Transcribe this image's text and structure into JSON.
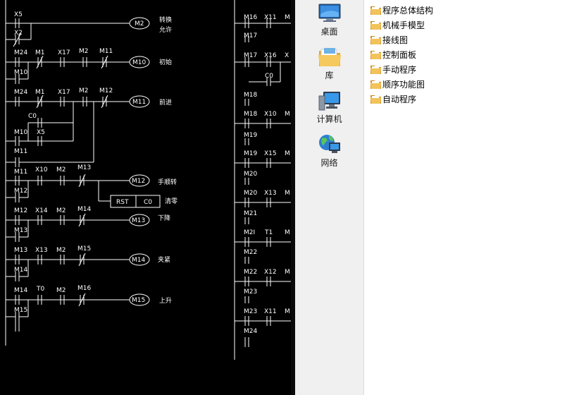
{
  "ladder": {
    "left_rungs": [
      {
        "coil": "M2",
        "comment": [
          "转换",
          "允许"
        ],
        "contacts": [
          "X5"
        ],
        "branch": [
          "X2"
        ]
      },
      {
        "coil": "M10",
        "comment": [
          "初始"
        ],
        "contacts": [
          "M1",
          "X17",
          "M2",
          "M11"
        ],
        "branch": [
          "M24",
          "M10"
        ]
      },
      {
        "coil": "M11",
        "comment": [
          "前进"
        ],
        "contacts": [
          "M1",
          "X17",
          "M2",
          "M12"
        ],
        "branch": [
          "M24",
          "C0",
          "M10",
          "X5",
          "M11"
        ]
      },
      {
        "coil": "M12",
        "comment": [
          "手顺转"
        ],
        "contacts": [
          "X10",
          "M2",
          "M13"
        ],
        "branch": [
          "M11",
          "M12"
        ]
      },
      {
        "instruction": "RST",
        "operand": "C0",
        "comment": [
          "清零"
        ]
      },
      {
        "coil": "M13",
        "comment": [
          "下降"
        ],
        "contacts": [
          "X14",
          "M2",
          "M14"
        ],
        "branch": [
          "M12",
          "M13"
        ]
      },
      {
        "coil": "M14",
        "comment": [
          "夹紧"
        ],
        "contacts": [
          "X13",
          "M2",
          "M15"
        ],
        "branch": [
          "M13",
          "M14"
        ]
      },
      {
        "coil": "M15",
        "comment": [
          "上升"
        ],
        "contacts": [
          "T0",
          "M2",
          "M16"
        ],
        "branch": [
          "M14",
          "M15"
        ]
      }
    ],
    "right_rungs": [
      {
        "left": "M16",
        "contact": "X11",
        "cut": "M"
      },
      {
        "left": "M17",
        "contact": "",
        "cut": ""
      },
      {
        "left": "M17",
        "contact": "X16",
        "cut": "X"
      },
      {
        "left": "",
        "contact": "C0",
        "cut": ""
      },
      {
        "left": "M18",
        "contact": "",
        "cut": ""
      },
      {
        "left": "M18",
        "contact": "X10",
        "cut": "M"
      },
      {
        "left": "M19",
        "contact": "",
        "cut": ""
      },
      {
        "left": "M19",
        "contact": "X15",
        "cut": "M"
      },
      {
        "left": "M20",
        "contact": "",
        "cut": ""
      },
      {
        "left": "M20",
        "contact": "X13",
        "cut": "M"
      },
      {
        "left": "M21",
        "contact": "",
        "cut": ""
      },
      {
        "left": "M2I",
        "contact": "T1",
        "cut": "M"
      },
      {
        "left": "M22",
        "contact": "",
        "cut": ""
      },
      {
        "left": "M22",
        "contact": "X12",
        "cut": "M"
      },
      {
        "left": "M23",
        "contact": "",
        "cut": ""
      },
      {
        "left": "M23",
        "contact": "X11",
        "cut": "M"
      },
      {
        "left": "M24",
        "contact": "",
        "cut": ""
      }
    ]
  },
  "nav": [
    {
      "label": "桌面",
      "icon": "desktop-icon"
    },
    {
      "label": "库",
      "icon": "library-folder-icon"
    },
    {
      "label": "计算机",
      "icon": "computer-icon"
    },
    {
      "label": "网络",
      "icon": "network-icon"
    }
  ],
  "files": [
    {
      "name": "程序总体结构",
      "icon": "folder-icon"
    },
    {
      "name": "机械手模型",
      "icon": "folder-icon"
    },
    {
      "name": "接线图",
      "icon": "folder-icon"
    },
    {
      "name": "控制面板",
      "icon": "folder-icon"
    },
    {
      "name": "手动程序",
      "icon": "folder-icon"
    },
    {
      "name": "顺序功能图",
      "icon": "folder-icon"
    },
    {
      "name": "自动程序",
      "icon": "folder-icon"
    }
  ],
  "colors": {
    "ladder_bg": "#000000",
    "ladder_line": "#ffffff",
    "nav_bg": "#f0f0f0",
    "folder": "#e8b84a"
  }
}
